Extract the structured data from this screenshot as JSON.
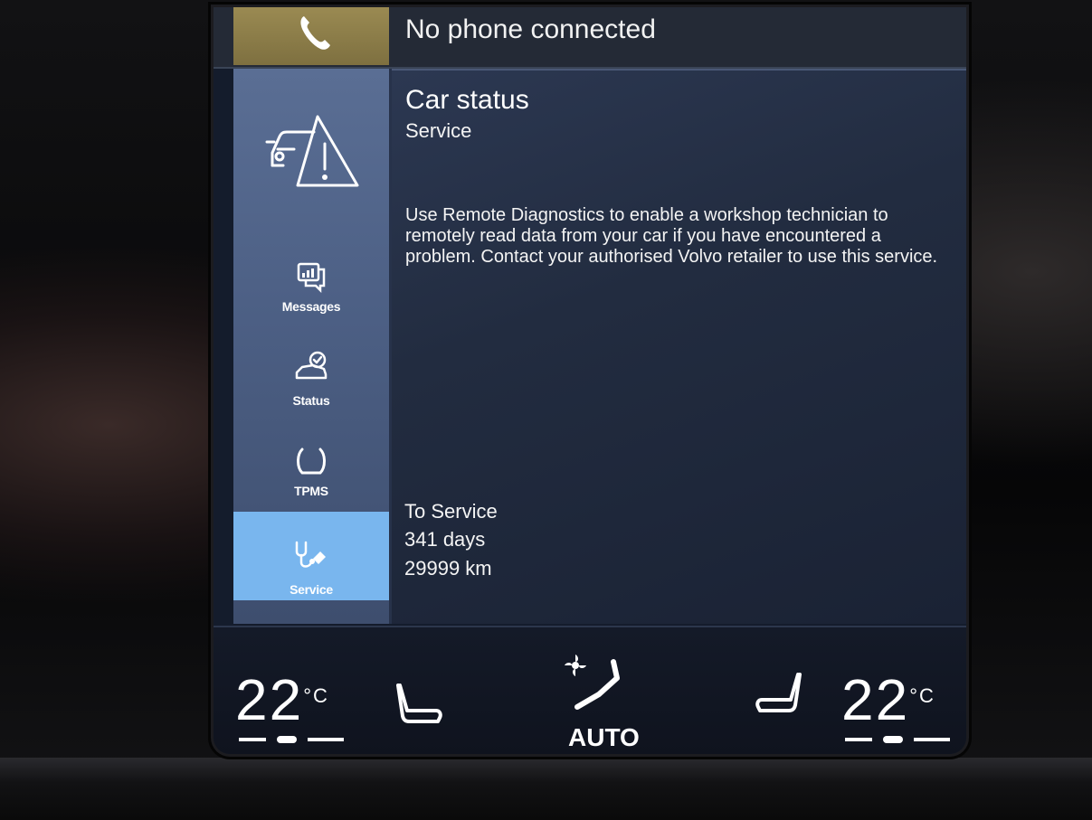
{
  "phone": {
    "icon": "phone-handset-icon",
    "status": "No phone connected"
  },
  "sidebar": {
    "header_icon": "car-warning-icon",
    "items": [
      {
        "label": "Messages",
        "icon": "messages-icon",
        "active": false
      },
      {
        "label": "Status",
        "icon": "car-status-icon",
        "active": false
      },
      {
        "label": "TPMS",
        "icon": "tire-pressure-icon",
        "active": false
      },
      {
        "label": "Service",
        "icon": "stethoscope-icon",
        "active": true
      }
    ]
  },
  "main": {
    "title": "Car status",
    "subtitle": "Service",
    "description": "Use Remote Diagnostics to enable a workshop technician to remotely read data from your car if you have encountered a problem. Contact your authorised Volvo retailer to use this service.",
    "service": {
      "label": "To Service",
      "days": "341 days",
      "distance": "29999 km"
    }
  },
  "climate": {
    "left_temp": "22",
    "right_temp": "22",
    "unit": "°C",
    "mode": "AUTO",
    "left_seat_icon": "seat-heat-icon",
    "right_seat_icon": "seat-heat-icon",
    "fan_icon": "auto-climate-fan-icon"
  },
  "colors": {
    "active_tab": "#79b6ee",
    "sidebar": "#4c5f84",
    "phone_tile": "#8a7c48"
  }
}
